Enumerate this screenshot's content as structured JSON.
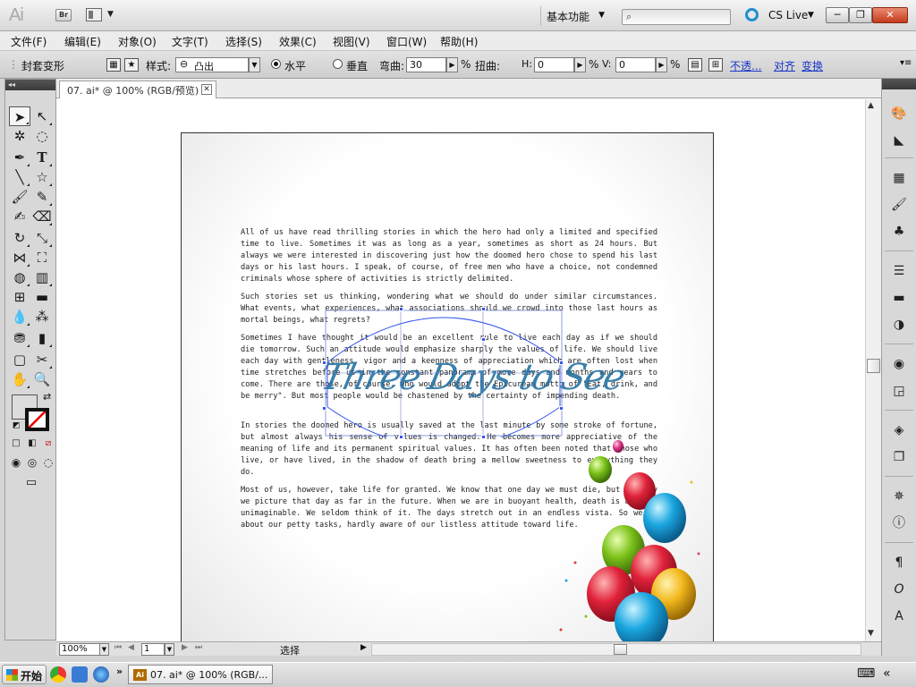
{
  "app": {
    "logo": "Ai",
    "bridge_label": "Br",
    "workspace": "基本功能",
    "cs_live": "CS Live",
    "min": "─",
    "max": "❐",
    "close": "✕"
  },
  "menu": [
    "文件(F)",
    "编辑(E)",
    "对象(O)",
    "文字(T)",
    "选择(S)",
    "效果(C)",
    "视图(V)",
    "窗口(W)",
    "帮助(H)"
  ],
  "control": {
    "title": "封套变形",
    "style_label": "样式:",
    "style_value": "凸出",
    "horizontal": "水平",
    "vertical": "垂直",
    "bend_label": "弯曲:",
    "bend_value": "30",
    "bend_unit": "%",
    "distort_label": "扭曲:",
    "h_label": "H:",
    "h_value": "0",
    "h_unit": "%",
    "v_label": "V:",
    "v_value": "0",
    "v_unit": "%",
    "opacity_link": "不透...",
    "align_link": "对齐",
    "transform_link": "变换"
  },
  "doc_tab": "07. ai* @ 100% (RGB/预览)",
  "document": {
    "paragraphs": [
      "All of us have read thrilling stories in which the hero had only a limited and specified time to live. Sometimes it was as long as a year, sometimes as short as 24 hours. But always we were interested in discovering just how the doomed hero chose to spend his last days or his last hours. I speak, of course, of free men who have a choice, not condemned criminals whose sphere of activities is strictly delimited.",
      "Such stories set us thinking, wondering what we should do under similar circumstances. What events, what experiences, what associations should we crowd into those last hours as mortal beings, what regrets?",
      "Sometimes I have thought it would be an excellent rule to live each day as if we should die tomorrow. Such an attitude would emphasize sharply the values of life. We should live each day with gentleness, vigor and a keenness of appreciation which are often lost when time stretches before us in the constant panorama of more days and months and years to come. There are those, of course, who would adopt the Epicurean motto of \"Eat, drink, and be merry\". But most people would be chastened by the certainty of impending death.",
      "In stories the doomed hero is usually saved at the last minute by some stroke of fortune, but almost always his sense of values is changed. He becomes more appreciative of the meaning of life and its permanent spiritual values. It has often been noted that those who live, or have lived, in the shadow of death bring a mellow sweetness to everything they do.",
      "Most of us, however, take life for granted. We know that one day we must die, but usually we picture that day as far in the future. When we are in buoyant health, death is all but unimaginable. We seldom think of it. The days stretch out in an endless vista. So we go about our petty tasks, hardly aware of our listless attitude toward life."
    ],
    "art_title": "Three Days to See"
  },
  "status": {
    "zoom": "100%",
    "page": "1",
    "text": "选择"
  },
  "taskbar": {
    "start": "开始",
    "task_item": "07. ai* @ 100% (RGB/..."
  },
  "colors": {
    "accent": "#1f8fcf",
    "title_art": "#1f6fa0",
    "anchor": "#3355ee"
  }
}
